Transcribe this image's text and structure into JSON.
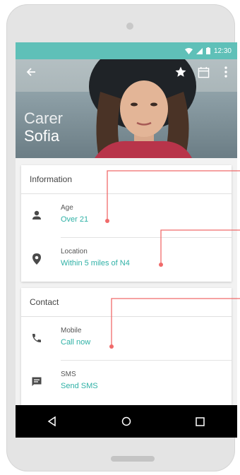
{
  "status_bar": {
    "time": "12:30"
  },
  "profile": {
    "title_line1": "Carer",
    "title_line2": "Sofia"
  },
  "information_card": {
    "header": "Information",
    "rows": [
      {
        "label": "Age",
        "value": "Over 21"
      },
      {
        "label": "Location",
        "value": "Within 5 miles of N4"
      }
    ]
  },
  "contact_card": {
    "header": "Contact",
    "rows": [
      {
        "label": "Mobile",
        "value": "Call now"
      },
      {
        "label": "SMS",
        "value": "Send SMS"
      }
    ]
  },
  "colors": {
    "accent": "#2fb1a6",
    "status_bar": "#5fc0b8",
    "annotation": "#f06a6a"
  },
  "icons": {
    "back": "arrow-back-icon",
    "favorite": "star-icon",
    "calendar": "calendar-icon",
    "more": "more-vert-icon",
    "age": "person-icon",
    "location": "location-pin-icon",
    "mobile": "phone-icon",
    "sms": "message-icon"
  }
}
